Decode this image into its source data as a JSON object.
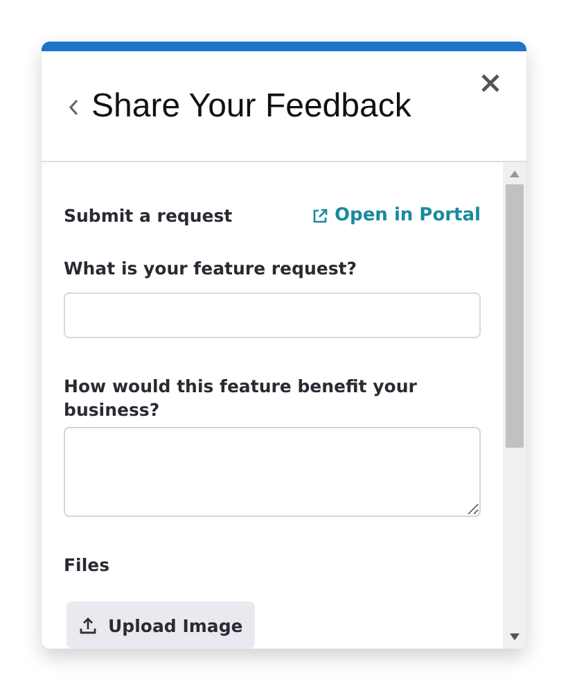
{
  "dialog": {
    "title": "Share Your Feedback"
  },
  "form": {
    "heading": "Submit a request",
    "portal_link": "Open in Portal",
    "fields": [
      {
        "kind": "input",
        "label": "What is your feature request?"
      },
      {
        "kind": "textarea",
        "label": "How would this feature benefit your business?"
      }
    ],
    "files_label": "Files",
    "upload_button": "Upload Image"
  }
}
